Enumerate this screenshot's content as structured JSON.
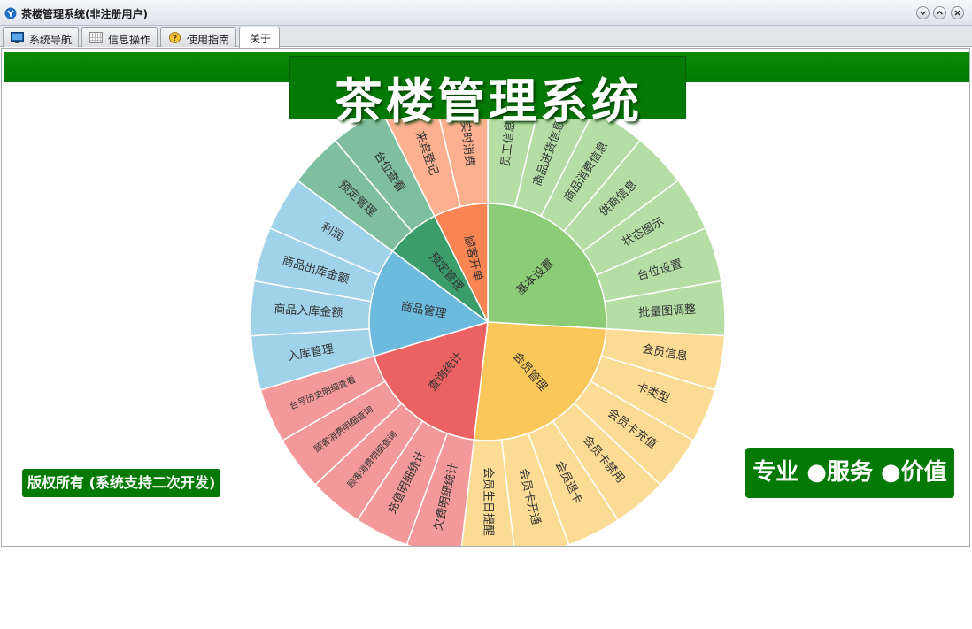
{
  "window": {
    "title": "茶楼管理系统(非注册用户)"
  },
  "tabs": [
    {
      "label": "系统导航",
      "icon": "monitor-icon",
      "active": false
    },
    {
      "label": "信息操作",
      "icon": "grid-icon",
      "active": false
    },
    {
      "label": "使用指南",
      "icon": "help-icon",
      "active": false
    },
    {
      "label": "关于",
      "icon": "",
      "active": true
    }
  ],
  "banner": {
    "title": "茶楼管理系统"
  },
  "footer": {
    "copyright": "版权所有 (系统支持二次开发)",
    "slogan": "专业 ●服务 ●价值"
  },
  "colors": {
    "brand_green": "#047a04"
  },
  "chart_data": {
    "type": "sunburst",
    "groups": [
      {
        "name": "基本设置",
        "color": "#8dcc76",
        "children": [
          "员工信息",
          "商品进货信息",
          "商品消费信息",
          "供商信息",
          "状态图示",
          "台位设置",
          "批量图调整"
        ]
      },
      {
        "name": "会员管理",
        "color": "#fac85a",
        "children": [
          "会员信息",
          "卡类型",
          "会员卡充值",
          "会员卡禁用",
          "会员退卡",
          "会员卡开通",
          "会员生日提醒"
        ]
      },
      {
        "name": "查询统计",
        "color": "#ec6262",
        "children": [
          "欠费明细统计",
          "充值明细统计",
          "顾客消费明细查询",
          "顾客消费明细查询",
          "台号历史明细查看"
        ]
      },
      {
        "name": "商品管理",
        "color": "#6dbadf",
        "children": [
          "入库管理",
          "商品入库金额",
          "商品出库金额",
          "利润"
        ]
      },
      {
        "name": "预定管理",
        "color": "#3a9d6a",
        "children": [
          "预定管理",
          "台位查看"
        ]
      },
      {
        "name": "顾客开单",
        "color": "#fb8552",
        "children": [
          "来宾登记",
          "实时消费"
        ]
      }
    ]
  }
}
